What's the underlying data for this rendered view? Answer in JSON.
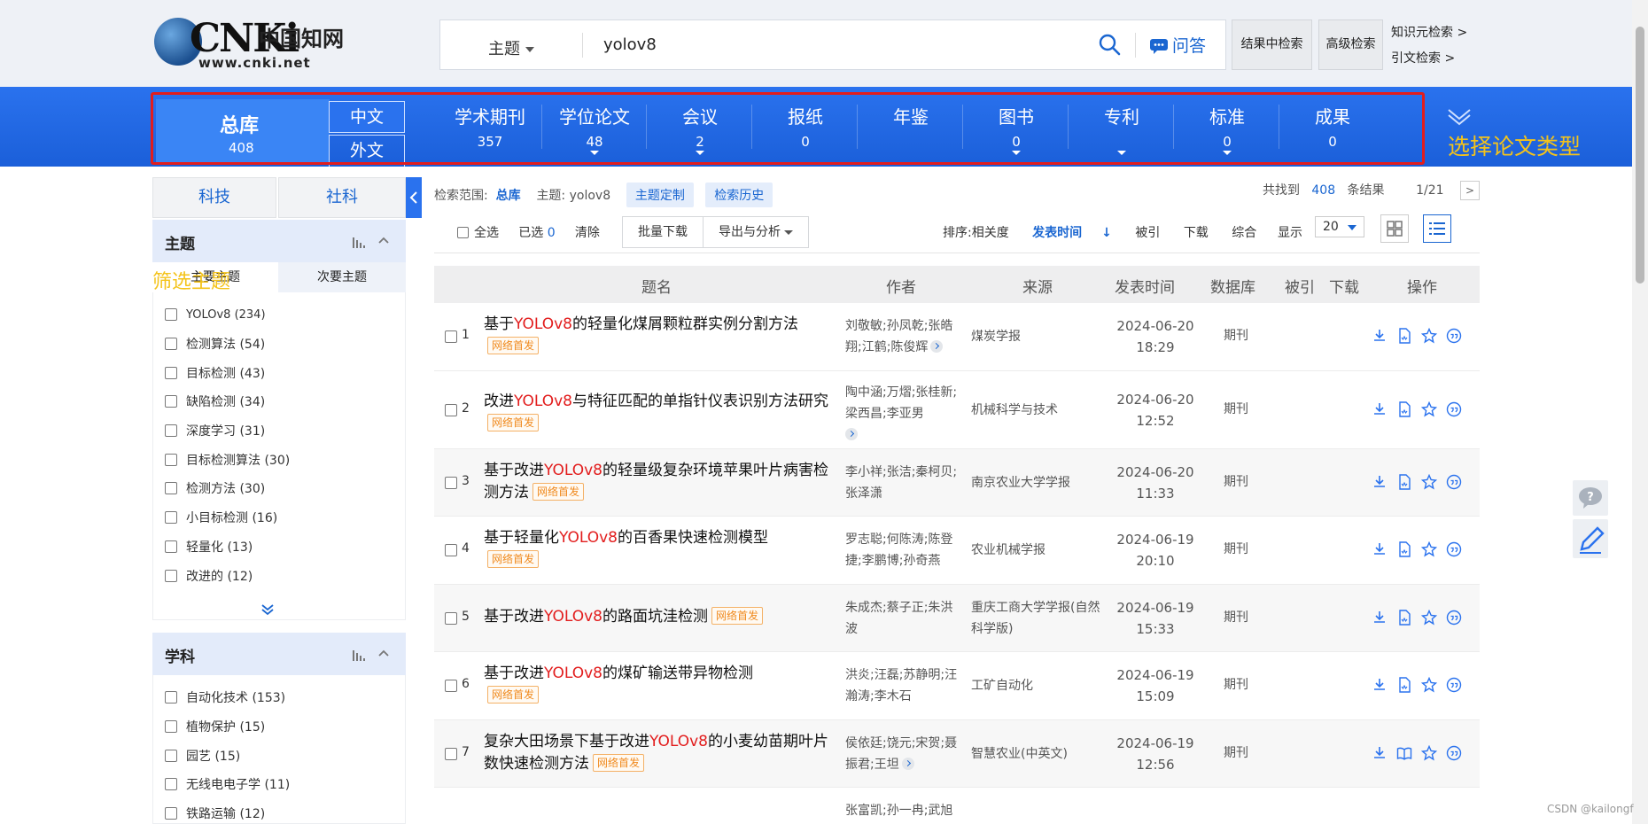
{
  "header": {
    "logo_word": "CNKi",
    "logo_cn": "中国知网",
    "logo_url": "www.cnki.net",
    "search_field": "主题",
    "search_query": "yolov8",
    "qa_label": "问答",
    "btn_in_results": "结果中检索",
    "btn_advanced": "高级检索",
    "link_knowledge": "知识元检索 >",
    "link_citation": "引文检索 >"
  },
  "nav": {
    "all": {
      "label": "总库",
      "count": "408"
    },
    "lang_zh": "中文",
    "lang_en": "外文",
    "items": [
      {
        "label": "学术期刊",
        "count": "357"
      },
      {
        "label": "学位论文",
        "count": "48"
      },
      {
        "label": "会议",
        "count": "2"
      },
      {
        "label": "报纸",
        "count": "0"
      },
      {
        "label": "年鉴",
        "count": ""
      },
      {
        "label": "图书",
        "count": "0"
      },
      {
        "label": "专利",
        "count": ""
      },
      {
        "label": "标准",
        "count": "0"
      },
      {
        "label": "成果",
        "count": "0"
      }
    ],
    "annotation": "选择论文类型"
  },
  "sidebar": {
    "tab_tech": "科技",
    "tab_social": "社科",
    "topic_panel": {
      "title": "主题",
      "sub_main": "主要主题",
      "sub_minor": "次要主题",
      "annotation": "筛选主题",
      "items": [
        "YOLOv8 (234)",
        "检测算法 (54)",
        "目标检测 (43)",
        "缺陷检测 (34)",
        "深度学习 (31)",
        "目标检测算法 (30)",
        "检测方法 (30)",
        "小目标检测 (16)",
        "轻量化 (13)",
        "改进的 (12)"
      ]
    },
    "subject_panel": {
      "title": "学科",
      "items": [
        "自动化技术 (153)",
        "植物保护 (15)",
        "园艺 (15)",
        "无线电电子学 (11)",
        "铁路运输 (12)"
      ]
    }
  },
  "results": {
    "scope_label": "检索范围:",
    "scope_value": "总库",
    "scope_topic": "主题: yolov8",
    "chip_custom": "主题定制",
    "chip_history": "检索历史",
    "found_prefix": "共找到",
    "found_count": "408",
    "found_suffix": "条结果",
    "page": "1/21",
    "select_all": "全选",
    "selected_label": "已选",
    "selected_count": "0",
    "clear": "清除",
    "bulk_download": "批量下载",
    "export": "导出与分析",
    "sort_label": "排序:",
    "sort_relevance": "相关度",
    "sort_date": "发表时间",
    "sort_cited": "被引",
    "sort_download": "下载",
    "sort_overall": "综合",
    "show_label": "显示",
    "page_size": "20",
    "columns": [
      "题名",
      "作者",
      "来源",
      "发表时间",
      "数据库",
      "被引",
      "下载",
      "操作"
    ],
    "badge": "网络首发",
    "rows": [
      {
        "num": "1",
        "pre": "基于",
        "hl": "YOLOv8",
        "post": "的轻量化煤屑颗粒群实例分割方法",
        "authors": "刘敬敏;孙凤乾;张皓翔;江鹤;陈俊辉",
        "source": "煤炭学报",
        "date": "2024-06-20",
        "time": "18:29",
        "db": "期刊"
      },
      {
        "num": "2",
        "pre": "改进",
        "hl": "YOLOv8",
        "post": "与特征匹配的单指针仪表识别方法研究",
        "authors": "陶中涵;万熠;张桂新;梁西昌;李亚男",
        "source": "机械科学与技术",
        "date": "2024-06-20",
        "time": "12:52",
        "db": "期刊"
      },
      {
        "num": "3",
        "pre": "基于改进",
        "hl": "YOLOv8",
        "post": "的轻量级复杂环境苹果叶片病害检测方法",
        "authors": "李小祥;张洁;秦柯贝;张泽潇",
        "source": "南京农业大学学报",
        "date": "2024-06-20",
        "time": "11:33",
        "db": "期刊"
      },
      {
        "num": "4",
        "pre": "基于轻量化",
        "hl": "YOLOv8",
        "post": "的百香果快速检测模型",
        "authors": "罗志聪;何陈涛;陈登捷;李鹏博;孙奇燕",
        "source": "农业机械学报",
        "date": "2024-06-19",
        "time": "20:10",
        "db": "期刊"
      },
      {
        "num": "5",
        "pre": "基于改进",
        "hl": "YOLOv8",
        "post": "的路面坑洼检测",
        "authors": "朱成杰;蔡子正;朱洪波",
        "source": "重庆工商大学学报(自然科学版)",
        "date": "2024-06-19",
        "time": "15:33",
        "db": "期刊"
      },
      {
        "num": "6",
        "pre": "基于改进",
        "hl": "YOLOv8",
        "post": "的煤矿输送带异物检测",
        "authors": "洪炎;汪磊;苏静明;汪瀚涛;李木石",
        "source": "工矿自动化",
        "date": "2024-06-19",
        "time": "15:09",
        "db": "期刊"
      },
      {
        "num": "7",
        "pre": "复杂大田场景下基于改进",
        "hl": "YOLOv8",
        "post": "的小麦幼苗期叶片数快速检测方法",
        "authors": "侯依廷;饶元;宋贺;聂振君;王坦",
        "source": "智慧农业(中英文)",
        "date": "2024-06-19",
        "time": "12:56",
        "db": "期刊"
      }
    ],
    "row8_authors": "张富凯;孙一冉;武旭"
  },
  "watermark": "CSDN @kailongf"
}
